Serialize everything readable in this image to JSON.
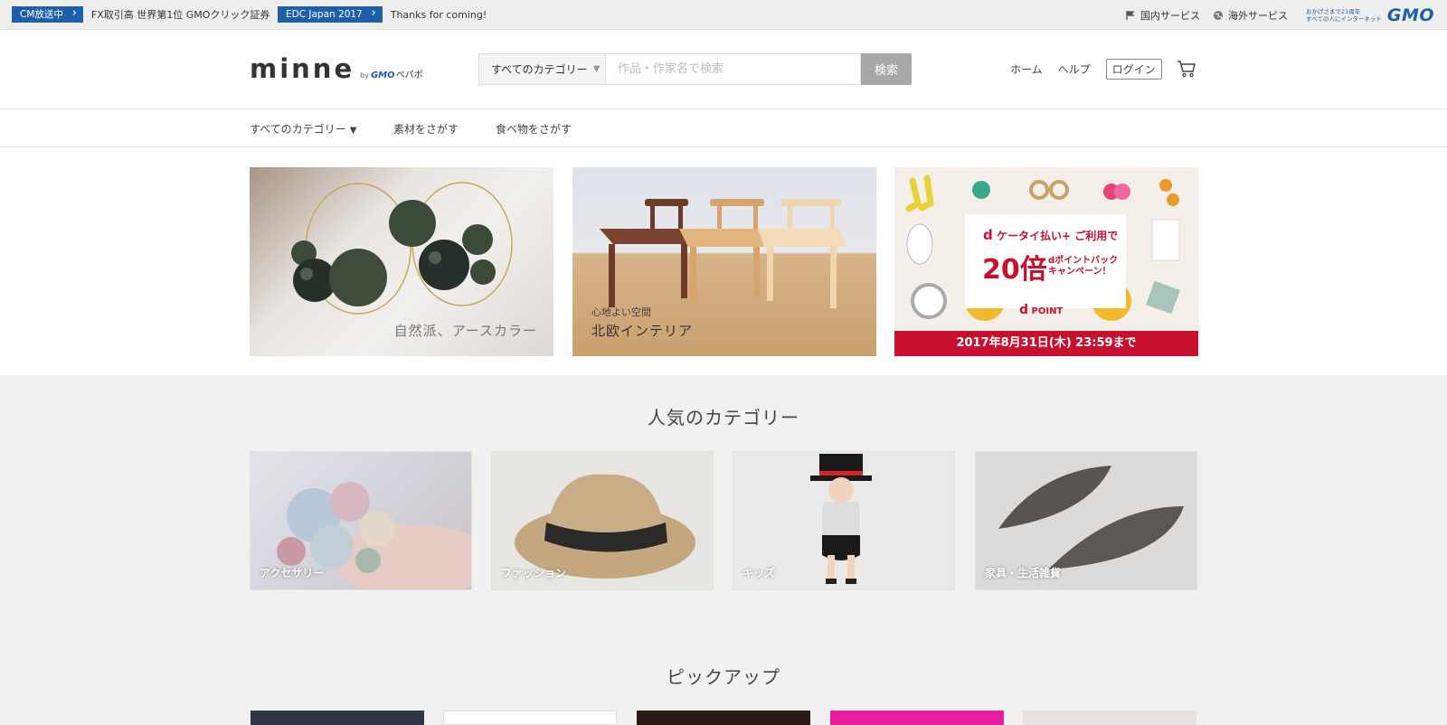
{
  "gmo_bar": {
    "news": [
      {
        "tag": "CM放送中",
        "text": "FX取引高 世界第1位 GMOクリック証券"
      },
      {
        "tag": "EDC Japan 2017",
        "text": "Thanks for coming!"
      }
    ],
    "services": [
      {
        "label": "国内サービス",
        "icon": "flag-icon"
      },
      {
        "label": "海外サービス",
        "icon": "globe-icon"
      }
    ],
    "logo_tagline_1": "おかげさまで21周年",
    "logo_tagline_2": "すべての人にインターネット",
    "logo_text": "GMO"
  },
  "header": {
    "logo_word": "minne",
    "logo_by": "by",
    "logo_gmo": "GMO",
    "logo_pepabo": "ペパボ",
    "search": {
      "category_label": "すべてのカテゴリー",
      "placeholder": "作品・作家名で検索",
      "button_label": "検索"
    },
    "nav": {
      "home": "ホーム",
      "help": "ヘルプ",
      "login": "ログイン",
      "cart_icon": "cart-icon"
    }
  },
  "subnav": {
    "items": [
      "すべてのカテゴリー",
      "素材をさがす",
      "食べ物をさがす"
    ]
  },
  "banners": [
    {
      "caption": "自然派、アースカラー"
    },
    {
      "subcaption": "心地よい空間",
      "caption": "北欧インテリア"
    },
    {
      "line1": "ケータイ払い",
      "line1b": "ご利用で",
      "big": "20倍",
      "side1": "dポイントバック",
      "side2": "キャンペーン！",
      "dpoint": "POINT",
      "footer": "2017年8月31日(木) 23:59まで"
    }
  ],
  "popular": {
    "title": "人気のカテゴリー",
    "categories": [
      "アクセサリー",
      "ファッション",
      "キッズ",
      "家具・生活雑貨"
    ]
  },
  "pickup": {
    "title": "ピックアップ"
  },
  "colors": {
    "gmo_blue": "#1d5fa8",
    "campaign_red": "#c8102e"
  }
}
